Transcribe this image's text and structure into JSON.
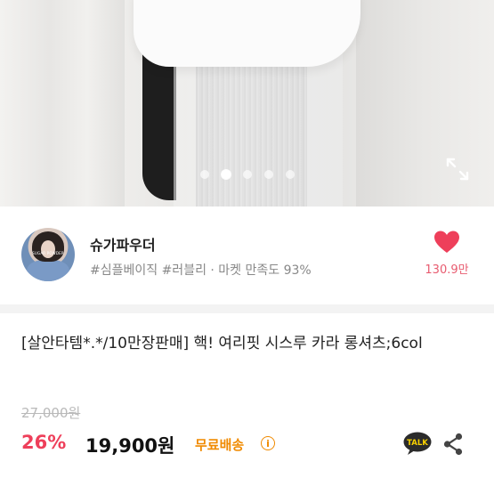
{
  "gallery": {
    "dots": [
      false,
      true,
      false,
      false,
      false,
      false
    ],
    "expand_icon": "expand-icon"
  },
  "seller": {
    "name": "슈가파우더",
    "meta": "#심플베이직 #러블리 · 마켓 만족도 93%",
    "avatar_text": "SUGAR POWDER",
    "likes": "130.9만",
    "heart_color": "#ee3f5a"
  },
  "product": {
    "title": "[살안타템*.*/10만장판매] 핵! 여리핏 시스루 카라 롱셔츠;6col",
    "original_price": "27,000원",
    "discount": "26%",
    "price": "19,900원",
    "shipping": "무료배송",
    "info_icon": "i"
  },
  "actions": {
    "talk_label": "TALK"
  },
  "colors": {
    "accent": "#ee3f5a",
    "shipping": "#f08a00",
    "talk_bg": "#2b2b2b",
    "talk_text": "#f7d000"
  }
}
